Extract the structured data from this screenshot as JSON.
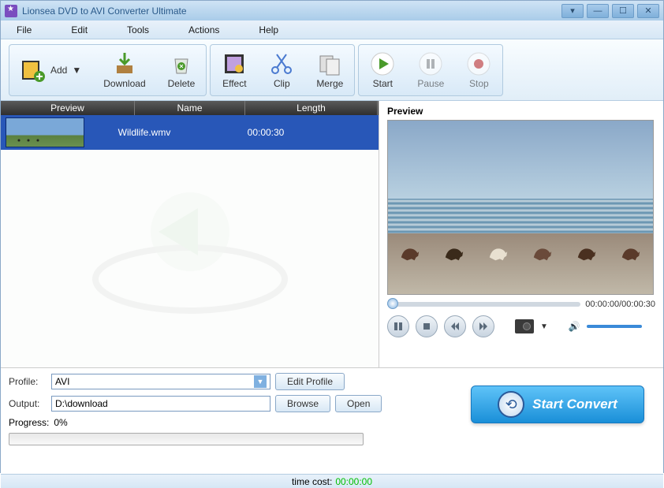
{
  "window": {
    "title": "Lionsea DVD to AVI Converter Ultimate"
  },
  "menu": {
    "file": "File",
    "edit": "Edit",
    "tools": "Tools",
    "actions": "Actions",
    "help": "Help"
  },
  "toolbar": {
    "add": "Add",
    "download": "Download",
    "delete": "Delete",
    "effect": "Effect",
    "clip": "Clip",
    "merge": "Merge",
    "start": "Start",
    "pause": "Pause",
    "stop": "Stop"
  },
  "list": {
    "headers": {
      "preview": "Preview",
      "name": "Name",
      "length": "Length"
    },
    "rows": [
      {
        "name": "Wildlife.wmv",
        "length": "00:00:30"
      }
    ]
  },
  "preview": {
    "label": "Preview",
    "time": "00:00:00/00:00:30"
  },
  "profile": {
    "label": "Profile:",
    "value": "AVI",
    "edit": "Edit Profile",
    "output_label": "Output:",
    "output_value": "D:\\download",
    "browse": "Browse",
    "open": "Open",
    "progress_label": "Progress:",
    "progress_value": "0%"
  },
  "convert": {
    "label": "Start Convert"
  },
  "footer": {
    "label": "time cost:",
    "value": "00:00:00"
  }
}
